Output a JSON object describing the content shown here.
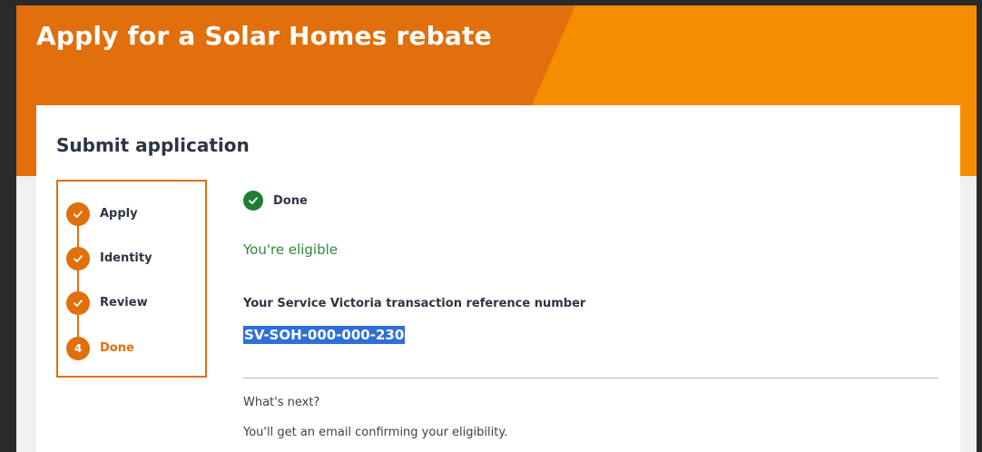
{
  "header": {
    "title": "Apply for a Solar Homes rebate"
  },
  "card": {
    "title": "Submit application"
  },
  "stepper": {
    "steps": [
      {
        "label": "Apply",
        "status": "complete",
        "marker": ""
      },
      {
        "label": "Identity",
        "status": "complete",
        "marker": ""
      },
      {
        "label": "Review",
        "status": "complete",
        "marker": ""
      },
      {
        "label": "Done",
        "status": "current",
        "marker": "4"
      }
    ]
  },
  "result": {
    "status_label": "Done",
    "eligibility": "You're eligible",
    "reference_label": "Your Service Victoria transaction reference number",
    "reference_number": "SV-SOH-000-000-230",
    "next_heading": "What's next?",
    "next_text": "You'll get an email confirming your eligibility."
  },
  "colors": {
    "brand_orange": "#f68d00",
    "brand_orange_dark": "#e06f0c",
    "success_green": "#1e7d34",
    "selection_blue": "#2f6fd6"
  }
}
